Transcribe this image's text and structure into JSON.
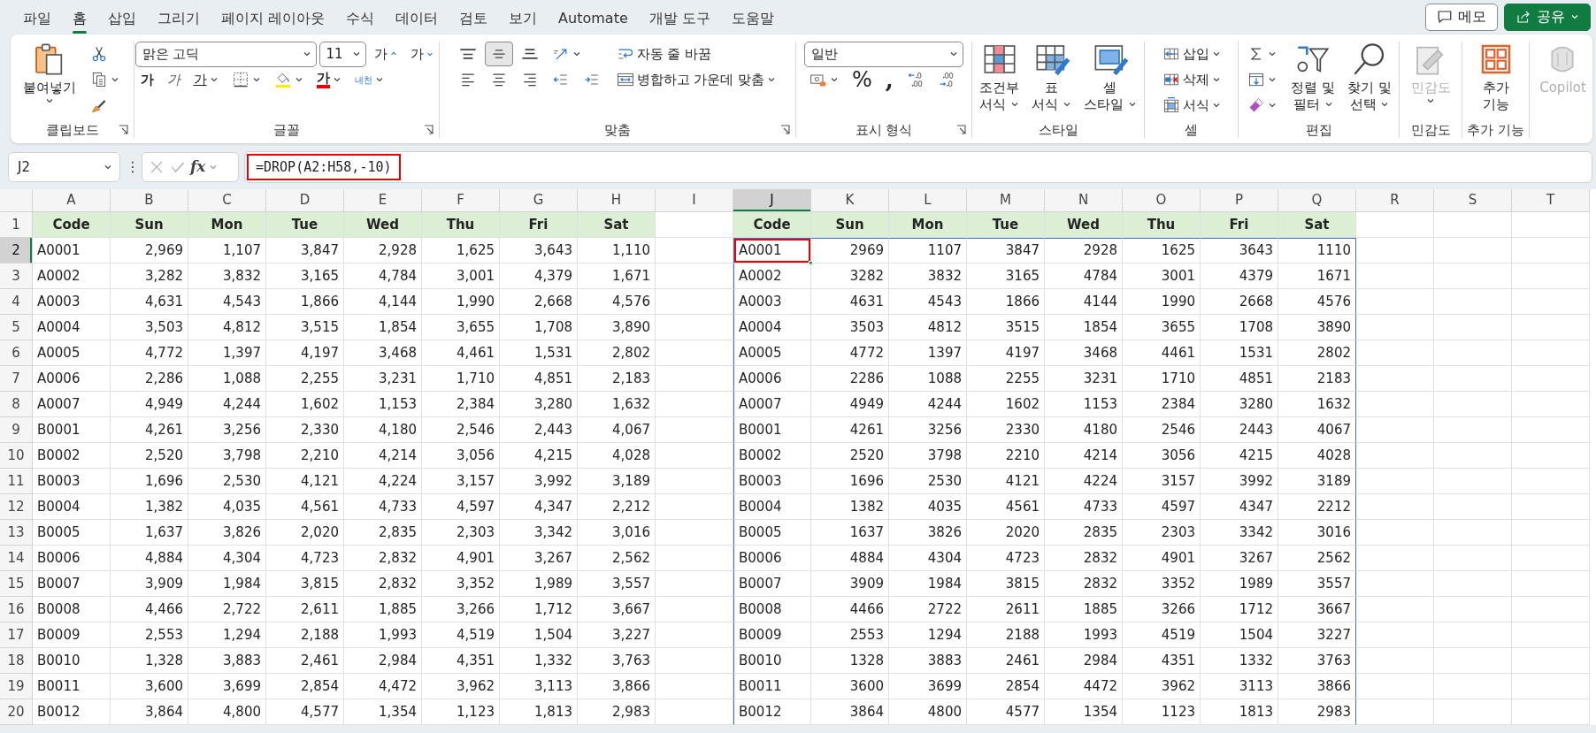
{
  "tabs": [
    {
      "label": "파일",
      "selected": false
    },
    {
      "label": "홈",
      "selected": true
    },
    {
      "label": "삽입",
      "selected": false
    },
    {
      "label": "그리기",
      "selected": false
    },
    {
      "label": "페이지 레이아웃",
      "selected": false
    },
    {
      "label": "수식",
      "selected": false
    },
    {
      "label": "데이터",
      "selected": false
    },
    {
      "label": "검토",
      "selected": false
    },
    {
      "label": "보기",
      "selected": false
    },
    {
      "label": "Automate",
      "selected": false
    },
    {
      "label": "개발 도구",
      "selected": false
    },
    {
      "label": "도움말",
      "selected": false
    }
  ],
  "actions": [
    {
      "kind": "comment",
      "label": "메모"
    },
    {
      "kind": "share",
      "label": "공유",
      "dropdown": true
    }
  ],
  "ribbon": {
    "groups": [
      {
        "label": "클립보드",
        "launcher": true,
        "blocks": [
          {
            "kind": "large",
            "lines": [
              "붙여넣기"
            ],
            "dropdown": true
          },
          {
            "kind": "stack",
            "lines": [
              [
                {
                  "kind": "icon"
                }
              ],
              [
                {
                  "kind": "icon",
                  "dropdown": true
                }
              ],
              [
                {
                  "kind": "icon"
                }
              ]
            ]
          }
        ]
      },
      {
        "label": "글꼴",
        "launcher": true,
        "blocks": [
          {
            "kind": "stack",
            "lines": [
              [
                {
                  "kind": "select",
                  "value": "맑은 고딕"
                },
                {
                  "kind": "select",
                  "value": "11"
                },
                {
                  "kind": "glyph",
                  "text": "가"
                },
                {
                  "kind": "glyph",
                  "text": "가"
                }
              ],
              [
                {
                  "kind": "glyph",
                  "text": "가"
                },
                {
                  "kind": "glyph",
                  "text": "가"
                },
                {
                  "kind": "glyph",
                  "text": "가",
                  "dropdown": true
                },
                {
                  "kind": "icon",
                  "dropdown": true
                },
                {
                  "kind": "icon",
                  "dropdown": true
                },
                {
                  "kind": "glyph",
                  "text": "가",
                  "dropdown": true
                },
                {
                  "kind": "glyph",
                  "text": "내천",
                  "dropdown": true
                }
              ]
            ]
          }
        ]
      },
      {
        "label": "맞춤",
        "launcher": true,
        "blocks": [
          {
            "kind": "stack",
            "lines": [
              [
                {
                  "kind": "icon",
                  "selected": false
                },
                {
                  "kind": "icon",
                  "selected": true
                },
                {
                  "kind": "icon",
                  "selected": false
                },
                {
                  "kind": "icon",
                  "dropdown": true
                }
              ],
              [
                {
                  "kind": "icon",
                  "selected": false
                },
                {
                  "kind": "icon",
                  "selected": false
                },
                {
                  "kind": "icon",
                  "selected": false
                },
                {
                  "kind": "icon"
                },
                {
                  "kind": "icon"
                }
              ]
            ]
          },
          {
            "kind": "stack",
            "lines": [
              [
                {
                  "kind": "small",
                  "label": "자동 줄 바꿈"
                }
              ],
              [
                {
                  "kind": "small",
                  "label": "병합하고 가운데 맞춤",
                  "dropdown": true
                }
              ]
            ]
          }
        ]
      },
      {
        "label": "표시 형식",
        "launcher": true,
        "blocks": [
          {
            "kind": "stack",
            "lines": [
              [
                {
                  "kind": "select",
                  "value": "일반"
                }
              ],
              [
                {
                  "kind": "icon",
                  "dropdown": true
                },
                {
                  "kind": "glyph",
                  "text": "%"
                },
                {
                  "kind": "glyph",
                  "text": ","
                },
                {
                  "kind": "icon"
                },
                {
                  "kind": "icon"
                }
              ]
            ]
          }
        ]
      },
      {
        "label": "스타일",
        "blocks": [
          {
            "kind": "large",
            "lines": [
              "조건부",
              "서식"
            ],
            "dropdown": true
          },
          {
            "kind": "large",
            "lines": [
              "표",
              "서식"
            ],
            "dropdown": true
          },
          {
            "kind": "large",
            "lines": [
              "셀",
              "스타일"
            ],
            "dropdown": true
          }
        ]
      },
      {
        "label": "셀",
        "blocks": [
          {
            "kind": "stack",
            "lines": [
              [
                {
                  "kind": "small",
                  "label": "삽입",
                  "dropdown": true
                }
              ],
              [
                {
                  "kind": "small",
                  "label": "삭제",
                  "dropdown": true
                }
              ],
              [
                {
                  "kind": "small",
                  "label": "서식",
                  "dropdown": true
                }
              ]
            ]
          }
        ]
      },
      {
        "label": "편집",
        "blocks": [
          {
            "kind": "stack",
            "lines": [
              [
                {
                  "kind": "icon",
                  "dropdown": true
                }
              ],
              [
                {
                  "kind": "icon",
                  "dropdown": true
                }
              ],
              [
                {
                  "kind": "icon",
                  "dropdown": true
                }
              ]
            ]
          },
          {
            "kind": "large",
            "lines": [
              "정렬 및",
              "필터"
            ],
            "dropdown": true
          },
          {
            "kind": "large",
            "lines": [
              "찾기 및",
              "선택"
            ],
            "dropdown": true
          }
        ]
      },
      {
        "label": "민감도",
        "blocks": [
          {
            "kind": "large",
            "lines": [
              "민감도"
            ],
            "dropdown": true,
            "disabled": true
          }
        ]
      },
      {
        "label": "추가 기능",
        "blocks": [
          {
            "kind": "large",
            "lines": [
              "추가",
              "기능"
            ]
          }
        ]
      },
      {
        "blocks": [
          {
            "kind": "large",
            "lines": [
              "Copilot"
            ],
            "disabled": true
          }
        ]
      }
    ]
  },
  "formula_bar": {
    "name_box": "J2",
    "more": "⋮",
    "function_label": "fx",
    "formula": "=DROP(A2:H58,-10)",
    "outlined": true
  },
  "sheet": {
    "columns": [
      {
        "label": "A",
        "selected": false
      },
      {
        "label": "B",
        "selected": false
      },
      {
        "label": "C",
        "selected": false
      },
      {
        "label": "D",
        "selected": false
      },
      {
        "label": "E",
        "selected": false
      },
      {
        "label": "F",
        "selected": false
      },
      {
        "label": "G",
        "selected": false
      },
      {
        "label": "H",
        "selected": false
      },
      {
        "label": "I",
        "selected": false
      },
      {
        "label": "J",
        "selected": true
      },
      {
        "label": "K",
        "selected": false
      },
      {
        "label": "L",
        "selected": false
      },
      {
        "label": "M",
        "selected": false
      },
      {
        "label": "N",
        "selected": false
      },
      {
        "label": "O",
        "selected": false
      },
      {
        "label": "P",
        "selected": false
      },
      {
        "label": "Q",
        "selected": false
      },
      {
        "label": "R",
        "selected": false
      },
      {
        "label": "S",
        "selected": false
      },
      {
        "label": "T",
        "selected": false
      }
    ],
    "row_numbers": [
      {
        "label": "1",
        "selected": false
      },
      {
        "label": "2",
        "selected": true
      },
      {
        "label": "3",
        "selected": false
      },
      {
        "label": "4",
        "selected": false
      },
      {
        "label": "5",
        "selected": false
      },
      {
        "label": "6",
        "selected": false
      },
      {
        "label": "7",
        "selected": false
      },
      {
        "label": "8",
        "selected": false
      },
      {
        "label": "9",
        "selected": false
      },
      {
        "label": "10",
        "selected": false
      },
      {
        "label": "11",
        "selected": false
      },
      {
        "label": "12",
        "selected": false
      },
      {
        "label": "13",
        "selected": false
      },
      {
        "label": "14",
        "selected": false
      },
      {
        "label": "15",
        "selected": false
      },
      {
        "label": "16",
        "selected": false
      },
      {
        "label": "17",
        "selected": false
      },
      {
        "label": "18",
        "selected": false
      },
      {
        "label": "19",
        "selected": false
      },
      {
        "label": "20",
        "selected": false
      }
    ],
    "source_table": {
      "header": [
        "Code",
        "Sun",
        "Mon",
        "Tue",
        "Wed",
        "Thu",
        "Fri",
        "Sat"
      ],
      "rows": [
        [
          "A0001",
          "2,969",
          "1,107",
          "3,847",
          "2,928",
          "1,625",
          "3,643",
          "1,110"
        ],
        [
          "A0002",
          "3,282",
          "3,832",
          "3,165",
          "4,784",
          "3,001",
          "4,379",
          "1,671"
        ],
        [
          "A0003",
          "4,631",
          "4,543",
          "1,866",
          "4,144",
          "1,990",
          "2,668",
          "4,576"
        ],
        [
          "A0004",
          "3,503",
          "4,812",
          "3,515",
          "1,854",
          "3,655",
          "1,708",
          "3,890"
        ],
        [
          "A0005",
          "4,772",
          "1,397",
          "4,197",
          "3,468",
          "4,461",
          "1,531",
          "2,802"
        ],
        [
          "A0006",
          "2,286",
          "1,088",
          "2,255",
          "3,231",
          "1,710",
          "4,851",
          "2,183"
        ],
        [
          "A0007",
          "4,949",
          "4,244",
          "1,602",
          "1,153",
          "2,384",
          "3,280",
          "1,632"
        ],
        [
          "B0001",
          "4,261",
          "3,256",
          "2,330",
          "4,180",
          "2,546",
          "2,443",
          "4,067"
        ],
        [
          "B0002",
          "2,520",
          "3,798",
          "2,210",
          "4,214",
          "3,056",
          "4,215",
          "4,028"
        ],
        [
          "B0003",
          "1,696",
          "2,530",
          "4,121",
          "4,224",
          "3,157",
          "3,992",
          "3,189"
        ],
        [
          "B0004",
          "1,382",
          "4,035",
          "4,561",
          "4,733",
          "4,597",
          "4,347",
          "2,212"
        ],
        [
          "B0005",
          "1,637",
          "3,826",
          "2,020",
          "2,835",
          "2,303",
          "3,342",
          "3,016"
        ],
        [
          "B0006",
          "4,884",
          "4,304",
          "4,723",
          "2,832",
          "4,901",
          "3,267",
          "2,562"
        ],
        [
          "B0007",
          "3,909",
          "1,984",
          "3,815",
          "2,832",
          "3,352",
          "1,989",
          "3,557"
        ],
        [
          "B0008",
          "4,466",
          "2,722",
          "2,611",
          "1,885",
          "3,266",
          "1,712",
          "3,667"
        ],
        [
          "B0009",
          "2,553",
          "1,294",
          "2,188",
          "1,993",
          "4,519",
          "1,504",
          "3,227"
        ],
        [
          "B0010",
          "1,328",
          "3,883",
          "2,461",
          "2,984",
          "4,351",
          "1,332",
          "3,763"
        ],
        [
          "B0011",
          "3,600",
          "3,699",
          "2,854",
          "4,472",
          "3,962",
          "3,113",
          "3,866"
        ],
        [
          "B0012",
          "3,864",
          "4,800",
          "4,577",
          "1,354",
          "1,123",
          "1,813",
          "2,983"
        ]
      ]
    },
    "result_table": {
      "header": [
        "Code",
        "Sun",
        "Mon",
        "Tue",
        "Wed",
        "Thu",
        "Fri",
        "Sat"
      ],
      "rows": [
        [
          "A0001",
          "2969",
          "1107",
          "3847",
          "2928",
          "1625",
          "3643",
          "1110"
        ],
        [
          "A0002",
          "3282",
          "3832",
          "3165",
          "4784",
          "3001",
          "4379",
          "1671"
        ],
        [
          "A0003",
          "4631",
          "4543",
          "1866",
          "4144",
          "1990",
          "2668",
          "4576"
        ],
        [
          "A0004",
          "3503",
          "4812",
          "3515",
          "1854",
          "3655",
          "1708",
          "3890"
        ],
        [
          "A0005",
          "4772",
          "1397",
          "4197",
          "3468",
          "4461",
          "1531",
          "2802"
        ],
        [
          "A0006",
          "2286",
          "1088",
          "2255",
          "3231",
          "1710",
          "4851",
          "2183"
        ],
        [
          "A0007",
          "4949",
          "4244",
          "1602",
          "1153",
          "2384",
          "3280",
          "1632"
        ],
        [
          "B0001",
          "4261",
          "3256",
          "2330",
          "4180",
          "2546",
          "2443",
          "4067"
        ],
        [
          "B0002",
          "2520",
          "3798",
          "2210",
          "4214",
          "3056",
          "4215",
          "4028"
        ],
        [
          "B0003",
          "1696",
          "2530",
          "4121",
          "4224",
          "3157",
          "3992",
          "3189"
        ],
        [
          "B0004",
          "1382",
          "4035",
          "4561",
          "4733",
          "4597",
          "4347",
          "2212"
        ],
        [
          "B0005",
          "1637",
          "3826",
          "2020",
          "2835",
          "2303",
          "3342",
          "3016"
        ],
        [
          "B0006",
          "4884",
          "4304",
          "4723",
          "2832",
          "4901",
          "3267",
          "2562"
        ],
        [
          "B0007",
          "3909",
          "1984",
          "3815",
          "2832",
          "3352",
          "1989",
          "3557"
        ],
        [
          "B0008",
          "4466",
          "2722",
          "2611",
          "1885",
          "3266",
          "1712",
          "3667"
        ],
        [
          "B0009",
          "2553",
          "1294",
          "2188",
          "1993",
          "4519",
          "1504",
          "3227"
        ],
        [
          "B0010",
          "1328",
          "3883",
          "2461",
          "2984",
          "4351",
          "1332",
          "3763"
        ],
        [
          "B0011",
          "3600",
          "3699",
          "2854",
          "4472",
          "3962",
          "3113",
          "3866"
        ],
        [
          "B0012",
          "3864",
          "4800",
          "4577",
          "1354",
          "1123",
          "1813",
          "2983"
        ]
      ]
    }
  }
}
